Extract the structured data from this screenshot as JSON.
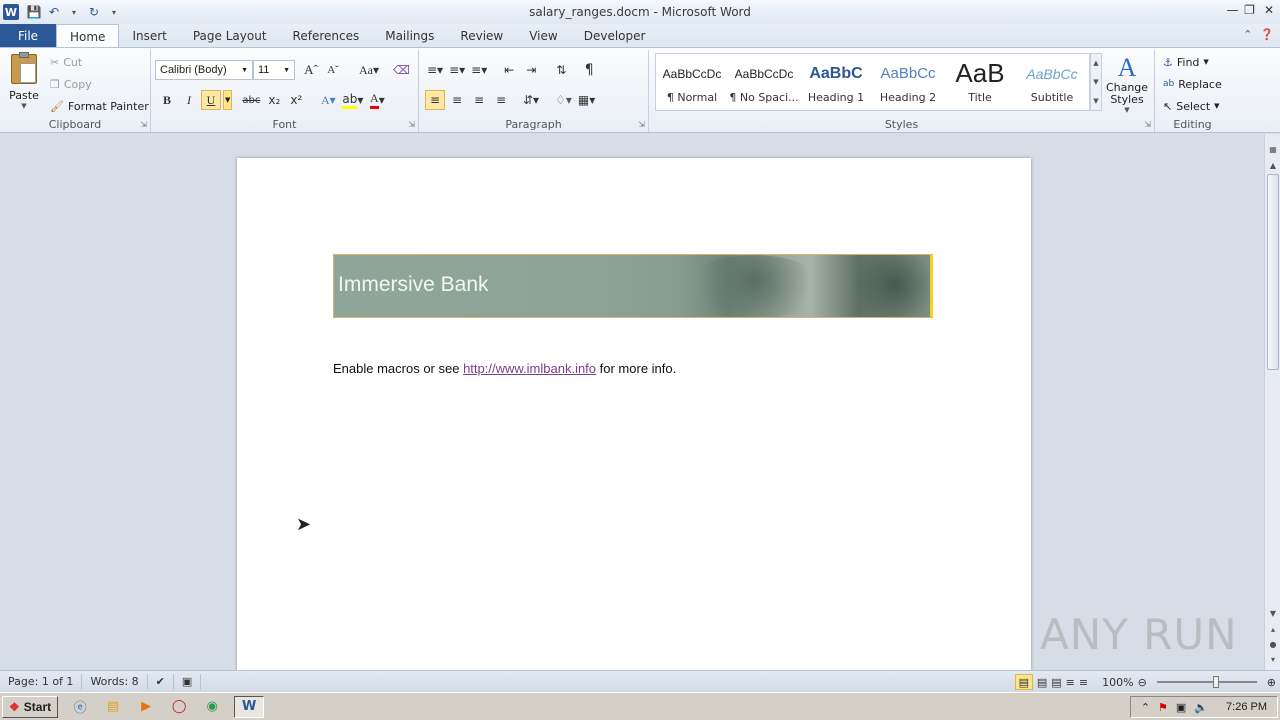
{
  "window": {
    "title": "salary_ranges.docm - Microsoft Word",
    "app_icon_letter": "W"
  },
  "tabs": {
    "file": "File",
    "items": [
      "Home",
      "Insert",
      "Page Layout",
      "References",
      "Mailings",
      "Review",
      "View",
      "Developer"
    ],
    "active": "Home"
  },
  "ribbon": {
    "clipboard": {
      "label": "Clipboard",
      "paste": "Paste",
      "cut": "Cut",
      "copy": "Copy",
      "format_painter": "Format Painter"
    },
    "font": {
      "label": "Font",
      "font_name": "Calibri (Body)",
      "font_size": "11"
    },
    "paragraph": {
      "label": "Paragraph"
    },
    "styles": {
      "label": "Styles",
      "gallery": [
        {
          "preview": "AaBbCcDc",
          "name": "¶ Normal"
        },
        {
          "preview": "AaBbCcDc",
          "name": "¶ No Spaci..."
        },
        {
          "preview": "AaBbC",
          "name": "Heading 1"
        },
        {
          "preview": "AaBbCc",
          "name": "Heading 2"
        },
        {
          "preview": "AaB",
          "name": "Title"
        },
        {
          "preview": "AaBbCc",
          "name": "Subtitle"
        }
      ],
      "change_styles": "Change Styles"
    },
    "editing": {
      "label": "Editing",
      "find": "Find",
      "replace": "Replace",
      "select": "Select"
    }
  },
  "document": {
    "banner_text": "Immersive Bank",
    "para_before": "Enable macros or see ",
    "link_text": "http://www.imlbank.info",
    "para_after": " for more info."
  },
  "status": {
    "page": "Page: 1 of 1",
    "words": "Words: 8",
    "zoom": "100%"
  },
  "taskbar": {
    "start": "Start",
    "time": "7:26 PM"
  },
  "watermark": "ANY RUN"
}
